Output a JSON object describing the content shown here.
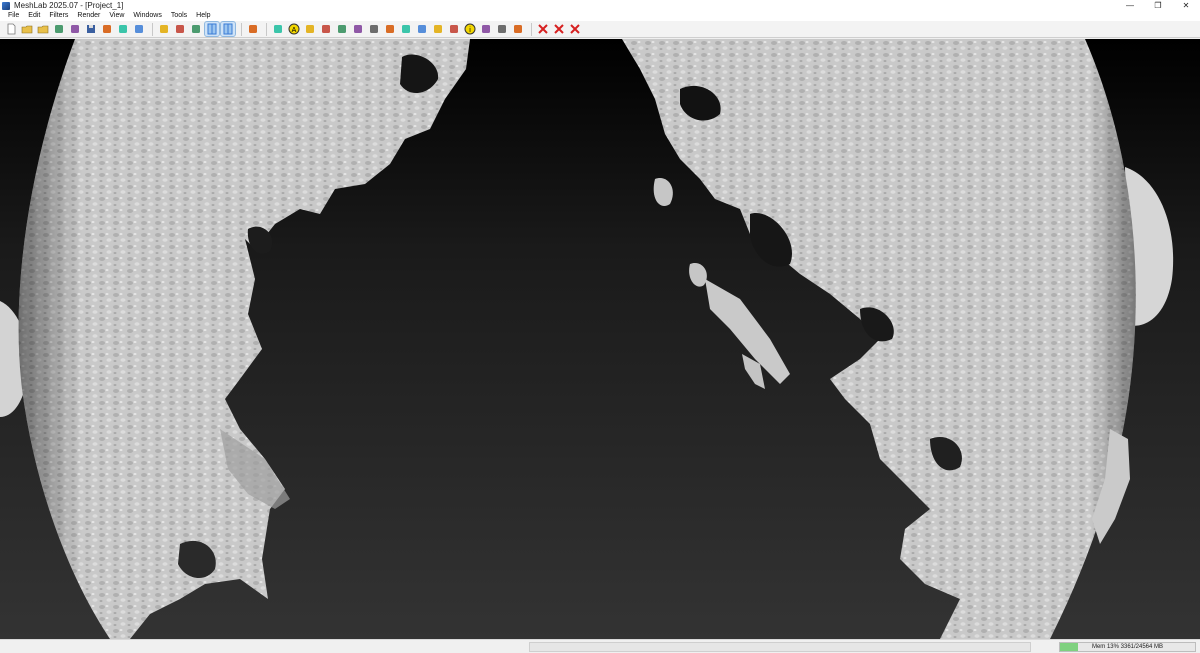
{
  "window": {
    "title": "MeshLab 2025.07 - [Project_1]",
    "controls": [
      "—",
      "❐",
      "✕"
    ]
  },
  "menu": {
    "items": [
      "File",
      "Edit",
      "Filters",
      "Render",
      "View",
      "Windows",
      "Tools",
      "Help"
    ]
  },
  "toolbar": {
    "groups": [
      [
        "new-icon",
        "open-project-icon",
        "open-icon",
        "reload-icon",
        "reload-all-icon",
        "save-icon",
        "snapshot-icon",
        "layers-icon",
        "console-icon"
      ],
      [
        "fullscreen-icon",
        "trackball-icon",
        "xray-icon",
        "split-h-icon",
        "split-v-icon"
      ],
      [
        "box-render-icon"
      ],
      [
        "vertex-icon",
        "annotation-icon",
        "pick-points-icon",
        "measure-icon",
        "paint-icon",
        "brush-icon",
        "select-faces-icon",
        "select-vertex-icon",
        "select-connected-icon",
        "select-cc-icon",
        "align-icon",
        "manipulator-icon",
        "info-icon",
        "texture-icon",
        "fill-holes-icon",
        "scale-icon"
      ],
      [
        "delete-faces-icon",
        "delete-vertices-icon",
        "delete-all-icon"
      ]
    ],
    "active": [
      "split-h-icon",
      "split-v-icon"
    ]
  },
  "statusbar": {
    "memory_text": "Mem 13% 3361/24564 MB",
    "memory_percent": 13,
    "colors": {
      "mem_fill": "#7fd17f"
    }
  },
  "viewport": {
    "background_top": "#000000",
    "background_bottom": "#333333",
    "mesh_color": "#c8c8c8"
  }
}
